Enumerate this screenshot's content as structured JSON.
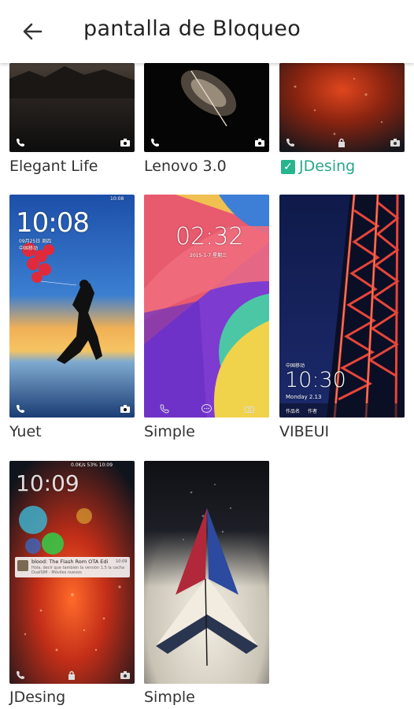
{
  "header": {
    "title": "pantalla de Bloqueo",
    "back_icon": "arrow-left-icon"
  },
  "themes": [
    {
      "name": "Elegant Life",
      "selected": false
    },
    {
      "name": "Lenovo 3.0",
      "selected": false
    },
    {
      "name": "JDesing",
      "selected": true
    },
    {
      "name": "Yuet",
      "selected": false,
      "preview": {
        "clock": "10:08",
        "date": "09月25日 周四",
        "carrier": "中国移动",
        "status_time": "10:08"
      }
    },
    {
      "name": "Simple",
      "selected": false,
      "preview": {
        "clock": "02:32",
        "date": "2015-1-7  星期三"
      }
    },
    {
      "name": "VIBEUI",
      "selected": false,
      "preview": {
        "carrier": "中国移动",
        "clock": "10:30",
        "date": "Monday 2.13",
        "bottom_left": "作品名",
        "bottom_right": "作者"
      }
    },
    {
      "name": "JDesing",
      "selected": false,
      "preview": {
        "clock": "10:09",
        "status": "0.0K/s  53%  10:09",
        "notif_title": "blood: The Flash Rom OTA Edi",
        "notif_time": "10:09",
        "notif_body": "Hola, decir que también la versión 1.5 la cacha DualSIM - Móviles nuevos"
      }
    },
    {
      "name": "Simple",
      "selected": false
    }
  ],
  "colors": {
    "accent": "#27a88a",
    "checkbox": "#27b58e"
  }
}
